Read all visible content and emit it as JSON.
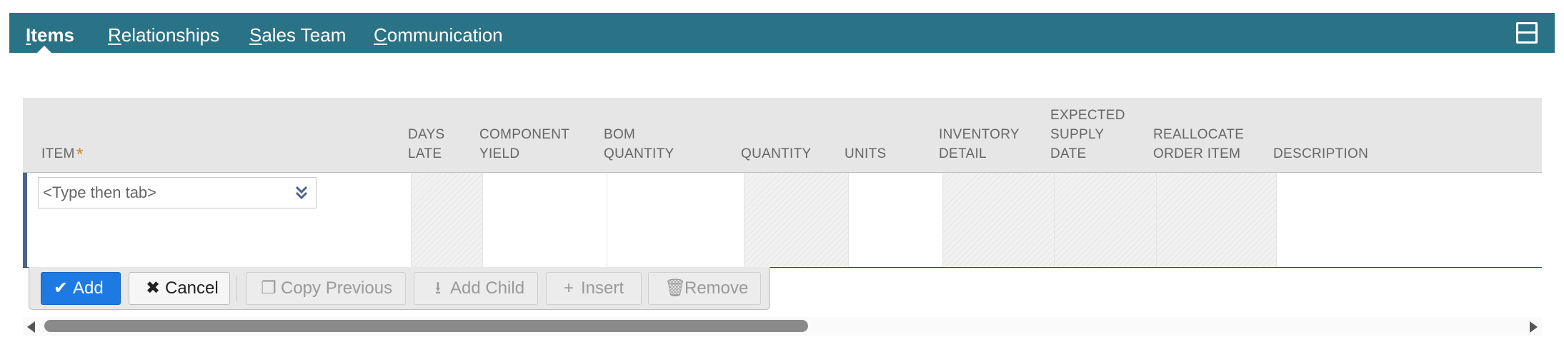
{
  "tabs": [
    {
      "label": "Items",
      "accesskey": "I",
      "rest": "tems",
      "active": true
    },
    {
      "label": "Relationships",
      "accesskey": "R",
      "rest": "elationships",
      "active": false
    },
    {
      "label": "Sales Team",
      "accesskey": "S",
      "rest": "ales Team",
      "active": false
    },
    {
      "label": "Communication",
      "accesskey": "C",
      "rest": "ommunication",
      "active": false
    }
  ],
  "header_icon": "menu-stack-icon",
  "columns": {
    "item": "ITEM",
    "item_required_mark": "*",
    "days_late": "DAYS\nLATE",
    "component_yield": "COMPONENT\nYIELD",
    "bom_quantity": "BOM\nQUANTITY",
    "quantity": "QUANTITY",
    "units": "UNITS",
    "inventory_detail": "INVENTORY\nDETAIL",
    "expected_supply_date": "EXPECTED\nSUPPLY\nDATE",
    "reallocate_order_item": "REALLOCATE\nORDER ITEM",
    "description": "DESCRIPTION"
  },
  "row": {
    "item_placeholder": "<Type then tab>",
    "item_value": ""
  },
  "actions": {
    "add": "Add",
    "cancel": "Cancel",
    "copy_previous": "Copy Previous",
    "add_child": "Add Child",
    "insert": "Insert",
    "remove": "Remove"
  },
  "colors": {
    "tabbar": "#2a7386",
    "primary_button": "#1d7ae3",
    "required_mark": "#d38b1f"
  }
}
